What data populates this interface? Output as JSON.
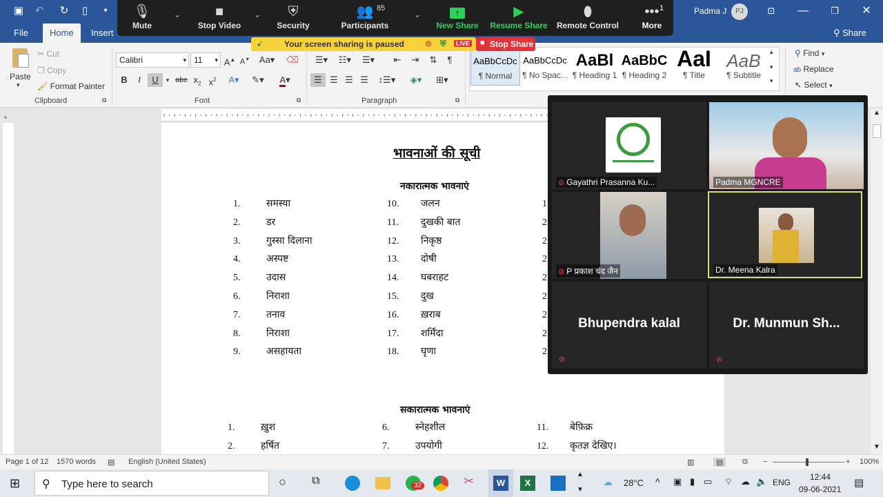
{
  "titlebar": {
    "user_name": "Padma J",
    "user_initials": "PJ",
    "share_label": "Share"
  },
  "tabs": [
    {
      "label": "File"
    },
    {
      "label": "Home"
    },
    {
      "label": "Insert"
    }
  ],
  "ribbon": {
    "paste": "Paste",
    "cut": "Cut",
    "copy": "Copy",
    "format_painter": "Format Painter",
    "clipboard_group": "Clipboard",
    "font_name": "Calibri",
    "font_size": "11",
    "font_group": "Font",
    "paragraph_group": "Paragraph",
    "styles": [
      {
        "preview": "AaBbCcDc",
        "name": "¶ Normal"
      },
      {
        "preview": "AaBbCcDc",
        "name": "¶ No Spac..."
      },
      {
        "preview": "AaBl",
        "name": "¶ Heading 1"
      },
      {
        "preview": "AaBbC",
        "name": "¶ Heading 2"
      },
      {
        "preview": "AaI",
        "name": "¶ Title"
      },
      {
        "preview": "AaB",
        "name": "¶ Subtitle"
      }
    ],
    "find": "Find",
    "replace": "Replace",
    "select": "Select"
  },
  "document": {
    "title": "भावनाओं की सूची",
    "negative_heading": "नकारात्मक भावनाएं",
    "negative_col1": [
      {
        "num": "1.",
        "text": "समस्या"
      },
      {
        "num": "2.",
        "text": "डर"
      },
      {
        "num": "3.",
        "text": "गुस्सा दिलाना"
      },
      {
        "num": "4.",
        "text": "अस्पष्ट"
      },
      {
        "num": "5.",
        "text": "उदास"
      },
      {
        "num": "6.",
        "text": "निराशा"
      },
      {
        "num": "7.",
        "text": "तनाव"
      },
      {
        "num": "8.",
        "text": "निराशा"
      },
      {
        "num": "9.",
        "text": "असहायता"
      }
    ],
    "negative_col2": [
      {
        "num": "10.",
        "text": "जलन"
      },
      {
        "num": "11.",
        "text": "दुखकी बात"
      },
      {
        "num": "12.",
        "text": "निकृष्ठ"
      },
      {
        "num": "13.",
        "text": "दोषी"
      },
      {
        "num": "14.",
        "text": "घबराहट"
      },
      {
        "num": "15.",
        "text": "दुख"
      },
      {
        "num": "16.",
        "text": "ख़राब"
      },
      {
        "num": "17.",
        "text": "शर्मिंदा"
      },
      {
        "num": "18.",
        "text": "घृणा"
      }
    ],
    "negative_col3_nums": [
      "1",
      "2",
      "2",
      "2",
      "2",
      "2",
      "2",
      "2",
      "2"
    ],
    "positive_heading": "सकारात्मक भावनाएं",
    "positive_col1": [
      {
        "num": "1.",
        "text": "ख़ुश"
      },
      {
        "num": "2.",
        "text": "हर्षित"
      }
    ],
    "positive_col2": [
      {
        "num": "6.",
        "text": "स्नेहशील"
      },
      {
        "num": "7.",
        "text": "उपयोगी"
      }
    ],
    "positive_col3": [
      {
        "num": "11.",
        "text": "बेफ़िक्र"
      },
      {
        "num": "12.",
        "text": "कृतज्ञ देखिए।"
      }
    ]
  },
  "statusbar": {
    "page": "Page 1 of 12",
    "words": "1570 words",
    "language": "English (United States)",
    "zoom": "100%"
  },
  "taskbar": {
    "search_placeholder": "Type here to search",
    "whatsapp_badge": "32",
    "temperature": "28°C",
    "lang": "ENG",
    "time": "12:44",
    "date": "09-06-2021"
  },
  "zoom_toolbar": {
    "items": [
      {
        "label": "Mute",
        "icon": "microphone-icon"
      },
      {
        "label": "Stop Video",
        "icon": "video-camera-icon"
      },
      {
        "label": "Security",
        "icon": "shield-icon"
      },
      {
        "label": "Participants",
        "icon": "participants-icon",
        "count": "85"
      },
      {
        "label": "New Share",
        "icon": "share-up-icon"
      },
      {
        "label": "Resume Share",
        "icon": "play-icon"
      },
      {
        "label": "Remote Control",
        "icon": "mouse-icon"
      },
      {
        "label": "More",
        "icon": "more-icon",
        "count": "1"
      }
    ],
    "paused_text": "Your screen sharing is paused",
    "live": "LIVE",
    "stop_share": "Stop Share",
    "green": "#2fd05a"
  },
  "gallery": {
    "tiles": [
      {
        "name": "Gayathri Prasanna Ku...",
        "muted": true
      },
      {
        "name": "Padma MGNCRE",
        "muted": false
      },
      {
        "name": "P प्रकाश चंद जैन",
        "muted": true
      },
      {
        "name": "Dr. Meena Kalra",
        "muted": false
      },
      {
        "name": "Bhupendra kalal",
        "muted": true
      },
      {
        "name": "Dr. Munmun Sh...",
        "muted": true
      }
    ],
    "active_border": "#d7e07a"
  }
}
